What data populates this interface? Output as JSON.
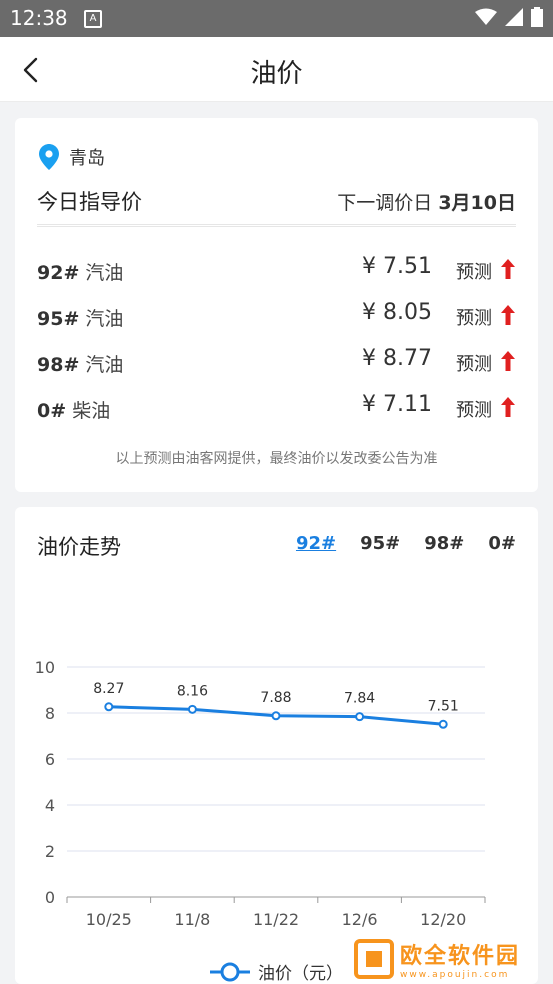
{
  "status_bar": {
    "time": "12:38",
    "notif_letter": "A"
  },
  "app_bar": {
    "title": "油价"
  },
  "guide": {
    "city": "青岛",
    "label": "今日指导价",
    "next_adjust_prefix": "下一调价日 ",
    "next_adjust_date": "3月10日",
    "rows": [
      {
        "grade": "92#",
        "type": "汽油",
        "price": "¥ 7.51",
        "pred": "预测",
        "trend": "up"
      },
      {
        "grade": "95#",
        "type": "汽油",
        "price": "¥ 8.05",
        "pred": "预测",
        "trend": "up"
      },
      {
        "grade": "98#",
        "type": "汽油",
        "price": "¥ 8.77",
        "pred": "预测",
        "trend": "up"
      },
      {
        "grade": "0#",
        "type": "柴油",
        "price": "¥ 7.11",
        "pred": "预测",
        "trend": "up"
      }
    ],
    "note": "以上预测由油客网提供，最终油价以发改委公告为准"
  },
  "trend": {
    "title": "油价走势",
    "tabs": [
      "92#",
      "95#",
      "98#",
      "0#"
    ],
    "active_tab": "92#"
  },
  "colors": {
    "accent": "#1a7fe0",
    "up_arrow": "#e02020",
    "line": "#1a7fe0"
  },
  "chart_data": {
    "type": "line",
    "categories": [
      "10/25",
      "11/8",
      "11/22",
      "12/6",
      "12/20"
    ],
    "series": [
      {
        "name": "油价（元）",
        "values": [
          8.27,
          8.16,
          7.88,
          7.84,
          7.51
        ]
      }
    ],
    "ylim": [
      0,
      10
    ],
    "yticks": [
      0,
      2,
      4,
      6,
      8,
      10
    ],
    "grid": true,
    "legend": "bottom"
  },
  "watermark": {
    "name": "欧全软件园",
    "url": "www.apoujin.com"
  }
}
